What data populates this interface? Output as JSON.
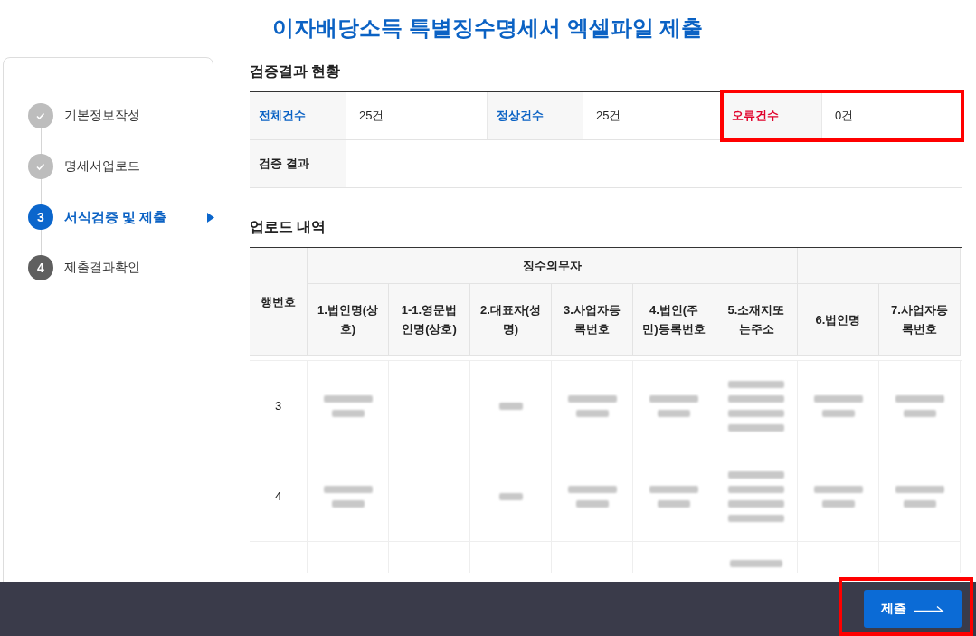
{
  "page": {
    "title": "이자배당소득 특별징수명세서 엑셀파일 제출"
  },
  "steps": [
    {
      "label": "기본정보작성",
      "kind": "done"
    },
    {
      "label": "명세서업로드",
      "kind": "done"
    },
    {
      "number": "3",
      "label": "서식검증 및 제출",
      "kind": "current"
    },
    {
      "number": "4",
      "label": "제출결과확인",
      "kind": "pending"
    }
  ],
  "summary": {
    "title": "검증결과 현황",
    "rows": [
      [
        {
          "label": "전체건수",
          "value": "25건",
          "kind": "total"
        },
        {
          "label": "정상건수",
          "value": "25건",
          "kind": "total"
        },
        {
          "label": "오류건수",
          "value": "0건",
          "kind": "error",
          "highlighted": true
        }
      ],
      [
        {
          "label": "검증 결과",
          "kind": "plain"
        }
      ]
    ]
  },
  "upload": {
    "title": "업로드 내역",
    "row_header": "행번호",
    "groups": [
      {
        "label": "징수의무자",
        "columns": [
          "1.법인명(상호)",
          "1-1.영문법인명(상호)",
          "2.대표자(성명)",
          "3.사업자등록번호",
          "4.법인(주민)등록번호",
          "5.소재지또는주소"
        ]
      },
      {
        "columns": [
          "6.법인명",
          "7.사업자등록번호"
        ]
      }
    ],
    "rows": [
      {
        "number": "3",
        "cells": [
          {
            "kind": "double"
          },
          {
            "kind": "blank"
          },
          {
            "kind": "single"
          },
          {
            "kind": "double"
          },
          {
            "kind": "double"
          },
          {
            "kind": "quad"
          },
          {
            "kind": "double"
          },
          {
            "kind": "double"
          }
        ]
      },
      {
        "number": "4",
        "cells": [
          {
            "kind": "double"
          },
          {
            "kind": "blank"
          },
          {
            "kind": "single"
          },
          {
            "kind": "double"
          },
          {
            "kind": "double"
          },
          {
            "kind": "quad"
          },
          {
            "kind": "double"
          },
          {
            "kind": "double"
          }
        ]
      },
      {
        "cells": [
          {
            "kind": "blank"
          },
          {
            "kind": "blank"
          },
          {
            "kind": "blank"
          },
          {
            "kind": "blank"
          },
          {
            "kind": "blank"
          },
          {
            "kind": "top"
          },
          {
            "kind": "blank"
          },
          {
            "kind": "blank"
          }
        ]
      }
    ]
  },
  "footer": {
    "submit": {
      "label": "제출",
      "highlighted": true
    }
  }
}
